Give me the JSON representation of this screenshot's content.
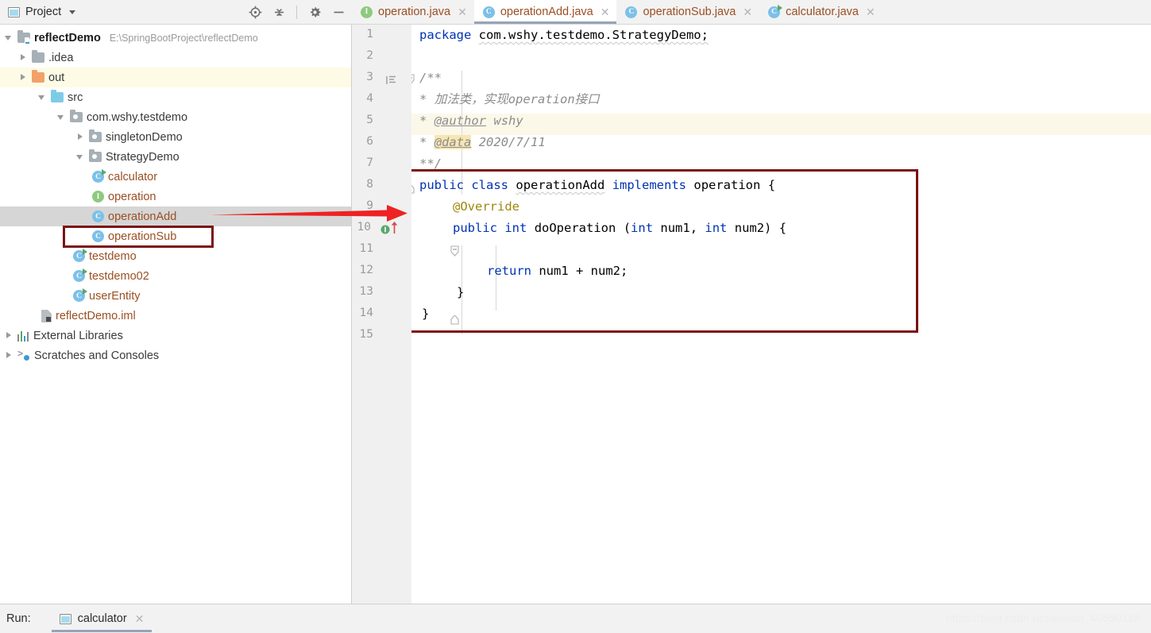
{
  "project_panel": {
    "title": "Project",
    "window_icon": "project-window-icon",
    "dropdown_icon": "chevron-down-icon",
    "tools": [
      {
        "name": "locate-icon",
        "label": "Select Opened File"
      },
      {
        "name": "collapse-all-icon",
        "label": "Collapse All"
      },
      {
        "name": "gear-icon",
        "label": "Settings"
      },
      {
        "name": "minimize-icon",
        "label": "Hide"
      }
    ]
  },
  "tree": [
    {
      "label": "reflectDemo",
      "path": "E:\\SpringBootProject\\reflectDemo",
      "indent": 0,
      "arrow": "open",
      "icon": "module-folder-icon",
      "bold": true
    },
    {
      "label": ".idea",
      "path": "",
      "indent": 1,
      "arrow": "closed",
      "icon": "folder-gray-icon",
      "bold": false
    },
    {
      "label": "out",
      "path": "",
      "indent": 1,
      "arrow": "closed",
      "icon": "folder-orange-icon",
      "bold": false
    },
    {
      "label": "src",
      "path": "",
      "indent": 1,
      "arrow": "open",
      "icon": "folder-blue-icon",
      "bold": false
    },
    {
      "label": "com.wshy.testdemo",
      "path": "",
      "indent": 2,
      "arrow": "open",
      "icon": "package-icon",
      "bold": false
    },
    {
      "label": "singletonDemo",
      "path": "",
      "indent": 3,
      "arrow": "closed",
      "icon": "package-icon",
      "bold": false
    },
    {
      "label": "StrategyDemo",
      "path": "",
      "indent": 3,
      "arrow": "open",
      "icon": "package-icon",
      "bold": false
    },
    {
      "label": "calculator",
      "path": "",
      "indent": 4,
      "arrow": "none",
      "icon": "java-class-runnable-icon",
      "bold": false
    },
    {
      "label": "operation",
      "path": "",
      "indent": 4,
      "arrow": "none",
      "icon": "java-interface-icon",
      "bold": false
    },
    {
      "label": "operationAdd",
      "path": "",
      "indent": 4,
      "arrow": "none",
      "icon": "java-class-icon",
      "bold": false
    },
    {
      "label": "operationSub",
      "path": "",
      "indent": 4,
      "arrow": "none",
      "icon": "java-class-icon",
      "bold": false
    },
    {
      "label": "testdemo",
      "path": "",
      "indent": 3,
      "arrow": "none",
      "icon": "java-class-runnable-icon",
      "bold": false
    },
    {
      "label": "testdemo02",
      "path": "",
      "indent": 3,
      "arrow": "none",
      "icon": "java-class-runnable-icon",
      "bold": false
    },
    {
      "label": "userEntity",
      "path": "",
      "indent": 3,
      "arrow": "none",
      "icon": "java-class-runnable-icon",
      "bold": false
    },
    {
      "label": "reflectDemo.iml",
      "path": "",
      "indent": 2,
      "arrow": "none",
      "icon": "iml-file-icon",
      "bold": false
    },
    {
      "label": "External Libraries",
      "path": "",
      "indent": 0,
      "arrow": "closed",
      "icon": "libraries-icon",
      "bold": false
    },
    {
      "label": "Scratches and Consoles",
      "path": "",
      "indent": 0,
      "arrow": "closed",
      "icon": "scratches-icon",
      "bold": false
    }
  ],
  "tabs": [
    {
      "label": "operation.java",
      "icon": "java-interface-icon",
      "active": false,
      "close_icon": "close-icon"
    },
    {
      "label": "operationAdd.java",
      "icon": "java-class-icon",
      "active": true,
      "close_icon": "close-icon"
    },
    {
      "label": "operationSub.java",
      "icon": "java-class-icon",
      "active": false,
      "close_icon": "close-icon"
    },
    {
      "label": "calculator.java",
      "icon": "java-class-runnable-icon",
      "active": false,
      "close_icon": "close-icon"
    }
  ],
  "editor": {
    "line_numbers": [
      "1",
      "2",
      "3",
      "4",
      "5",
      "6",
      "7",
      "8",
      "9",
      "10",
      "11",
      "12",
      "13",
      "14",
      "15"
    ],
    "caret_line": 4,
    "gutter_markers": [
      {
        "line": 3,
        "name": "javadoc-lines-icon"
      },
      {
        "line": 3,
        "name": "fold-collapse-icon"
      },
      {
        "line": 7,
        "name": "fold-end-icon"
      },
      {
        "line": 10,
        "name": "implementing-method-icon"
      },
      {
        "line": 10,
        "name": "fold-collapse-icon"
      },
      {
        "line": 13,
        "name": "fold-end-icon"
      }
    ],
    "code": [
      {
        "line": 1,
        "text": "package com.wshy.testdemo.StrategyDemo;"
      },
      {
        "line": 2,
        "text": ""
      },
      {
        "line": 3,
        "text": "/**"
      },
      {
        "line": 4,
        "text": " * 加法类，实现operation接口"
      },
      {
        "line": 5,
        "text": " * @author wshy"
      },
      {
        "line": 6,
        "text": " * @data 2020/7/11"
      },
      {
        "line": 7,
        "text": " **/"
      },
      {
        "line": 8,
        "text": "public class operationAdd implements operation {"
      },
      {
        "line": 9,
        "text": "    @Override"
      },
      {
        "line": 10,
        "text": "    public int doOperation (int num1, int num2) {"
      },
      {
        "line": 11,
        "text": ""
      },
      {
        "line": 12,
        "text": "        return num1 + num2;"
      },
      {
        "line": 13,
        "text": "    }"
      },
      {
        "line": 14,
        "text": "}"
      },
      {
        "line": 15,
        "text": ""
      }
    ],
    "tokens": {
      "package_kw": "package",
      "package_name": "com.wshy.testdemo.StrategyDemo;",
      "doc_open": "/**",
      "doc_star": "*",
      "doc_desc": "加法类，实现operation接口",
      "doc_author_tag": "@author",
      "doc_author_val": "wshy",
      "doc_data_tag": "@data",
      "doc_data_val": "2020/7/11",
      "doc_close": "**/",
      "kw_public": "public",
      "kw_class": "class",
      "class_name": "operationAdd",
      "kw_implements": "implements",
      "iface_name": "operation",
      "brace_open": "{",
      "annotation_override": "@Override",
      "kw_int": "int",
      "method_name": "doOperation",
      "param_open": "(",
      "param1": "num1,",
      "param2": "num2)",
      "kw_return": "return",
      "expr": "num1 + num2;",
      "brace_close": "}"
    }
  },
  "annotations": {
    "tree_box_color": "#7c1212",
    "code_box_color": "#7c1212",
    "arrow_color": "#ee2222",
    "arrow_target": "operationAdd"
  },
  "bottom": {
    "run_label": "Run:",
    "run_tab_name": "calculator",
    "run_tab_icon": "run-window-icon",
    "run_tab_close": "close-icon",
    "watermark": "https://blog.csdn.net/weixin_40550118"
  }
}
